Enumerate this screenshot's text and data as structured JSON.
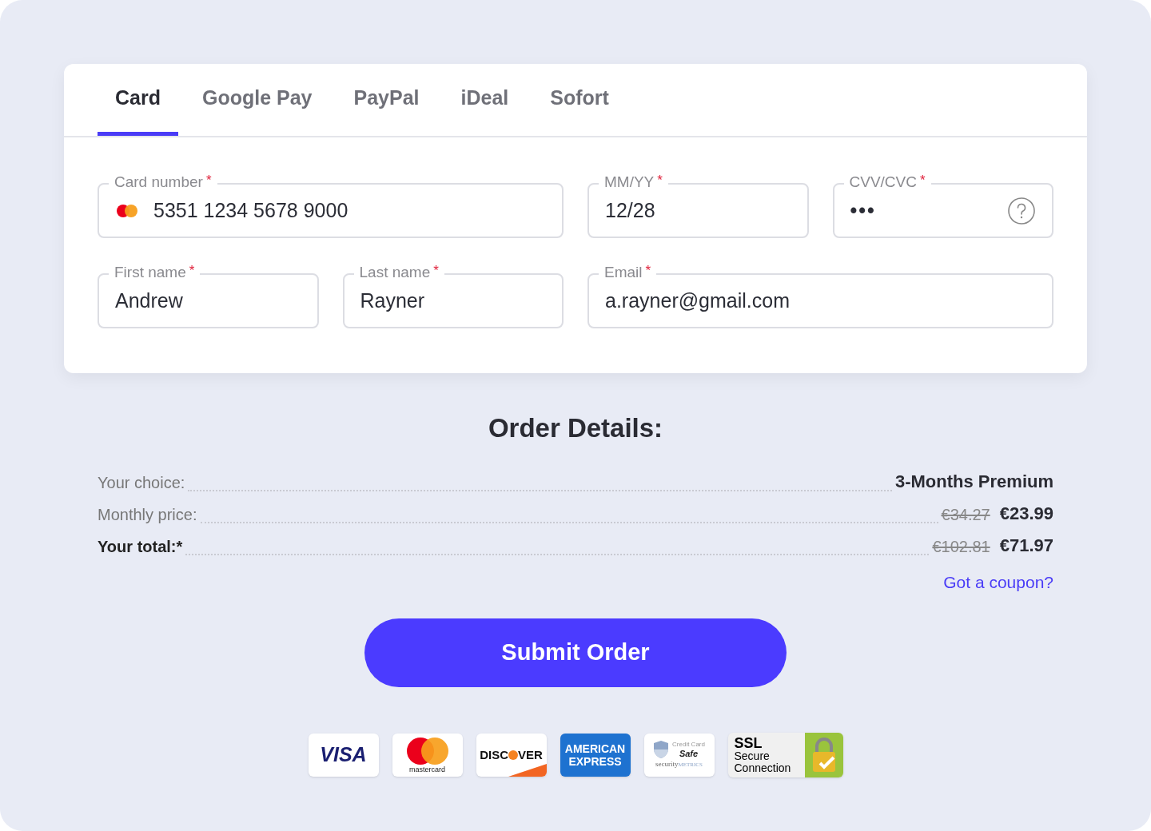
{
  "tabs": [
    {
      "label": "Card",
      "selected": true
    },
    {
      "label": "Google Pay",
      "selected": false
    },
    {
      "label": "PayPal",
      "selected": false
    },
    {
      "label": "iDeal",
      "selected": false
    },
    {
      "label": "Sofort",
      "selected": false
    }
  ],
  "fields": [
    {
      "label": "Card number",
      "required": "*",
      "value": "5351 1234 5678 9000",
      "kind": "card"
    },
    {
      "label": "MM/YY",
      "required": "*",
      "value": "12/28",
      "kind": "text"
    },
    {
      "label": "CVV/CVC",
      "required": "*",
      "value": "•••",
      "kind": "help"
    },
    {
      "label": "First name",
      "required": "*",
      "value": "Andrew",
      "kind": "text"
    },
    {
      "label": "Last name",
      "required": "*",
      "value": "Rayner",
      "kind": "text"
    },
    {
      "label": "Email",
      "required": "*",
      "value": "a.rayner@gmail.com",
      "kind": "email"
    }
  ],
  "order": {
    "title": "Order Details:",
    "rows": [
      {
        "label": "Your choice:",
        "bold": false,
        "value": "3-Months Premium"
      },
      {
        "label": "Monthly price:",
        "bold": false,
        "old_price": "€34.27",
        "value": "€23.99"
      },
      {
        "label": "Your total:*",
        "bold": true,
        "old_price": "€102.81",
        "value": "€71.97"
      }
    ],
    "coupon_link": "Got a coupon?"
  },
  "submit_button": "Submit Order",
  "badges": [
    {
      "kind": "visa",
      "texts": [
        "VISA"
      ]
    },
    {
      "kind": "mastercard",
      "texts": [
        "mastercard"
      ]
    },
    {
      "kind": "discover",
      "texts": [
        "DISC",
        "VER"
      ]
    },
    {
      "kind": "amex",
      "texts": [
        "AMERICAN",
        "EXPRESS"
      ]
    },
    {
      "kind": "securitymetrics",
      "texts": [
        "Credit Card",
        "Safe",
        "security",
        "METRICS"
      ]
    },
    {
      "kind": "ssl",
      "texts": [
        "SSL",
        "Secure",
        "Connection"
      ]
    }
  ]
}
